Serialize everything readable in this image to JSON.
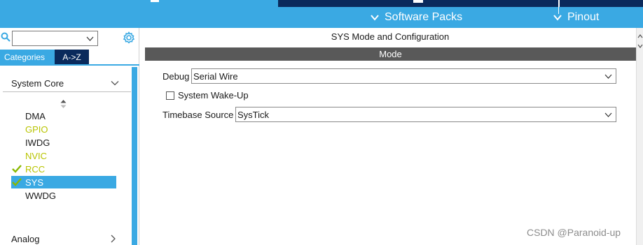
{
  "toolbar": {
    "software_packs_label": "Software Packs",
    "pinout_label": "Pinout"
  },
  "left_panel": {
    "search": {
      "value": ""
    },
    "tabs": [
      {
        "label": "Categories"
      },
      {
        "label": "A->Z"
      }
    ],
    "category": {
      "label": "System Core"
    },
    "items": [
      {
        "label": "DMA",
        "state": "normal"
      },
      {
        "label": "GPIO",
        "state": "warning"
      },
      {
        "label": "IWDG",
        "state": "normal"
      },
      {
        "label": "NVIC",
        "state": "warning"
      },
      {
        "label": "RCC",
        "state": "configured"
      },
      {
        "label": "SYS",
        "state": "selected-configured"
      },
      {
        "label": "WWDG",
        "state": "normal"
      }
    ],
    "next_category": {
      "label": "Analog"
    }
  },
  "main": {
    "title": "SYS Mode and Configuration",
    "mode_header": "Mode",
    "debug": {
      "label": "Debug",
      "value": "Serial Wire"
    },
    "wakeup": {
      "label": "System Wake-Up",
      "checked": false
    },
    "timebase": {
      "label": "Timebase Source",
      "value": "SysTick"
    }
  },
  "watermark": "CSDN @Paranoid-up",
  "colors": {
    "accent_blue": "#3aa9e3",
    "navy": "#0a2a5c",
    "mode_bar_gray": "#595959",
    "warning_yellow": "#b8c400",
    "check_green": "#8ab800"
  }
}
